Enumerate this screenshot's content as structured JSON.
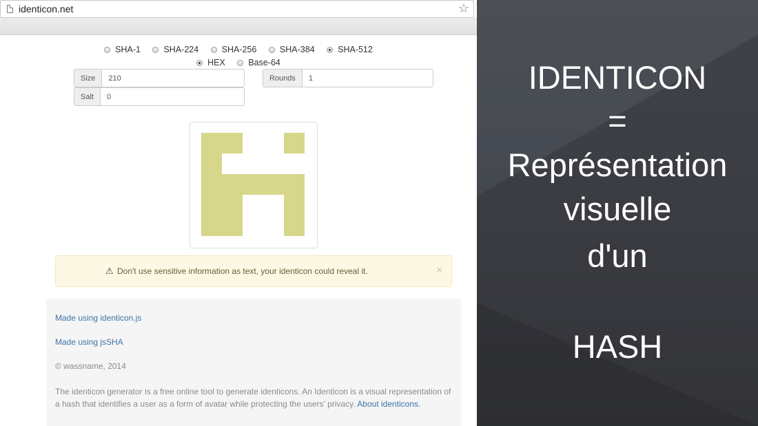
{
  "browser": {
    "url": "identicon.net"
  },
  "hash_options": {
    "algorithms": [
      {
        "label": "SHA-1",
        "selected": false
      },
      {
        "label": "SHA-224",
        "selected": false
      },
      {
        "label": "SHA-256",
        "selected": false
      },
      {
        "label": "SHA-384",
        "selected": false
      },
      {
        "label": "SHA-512",
        "selected": true
      }
    ],
    "encodings": [
      {
        "label": "HEX",
        "selected": true
      },
      {
        "label": "Base-64",
        "selected": false
      }
    ]
  },
  "fields": {
    "size_label": "Size",
    "size_value": "210",
    "rounds_label": "Rounds",
    "rounds_value": "1",
    "salt_label": "Salt",
    "salt_value": "0"
  },
  "identicon": {
    "color": "#d6d78a",
    "grid": [
      [
        1,
        1,
        0,
        0,
        1,
        1
      ],
      [
        1,
        0,
        0,
        0,
        0,
        1
      ],
      [
        1,
        1,
        1,
        1,
        1,
        1
      ],
      [
        1,
        1,
        0,
        0,
        1,
        1
      ],
      [
        1,
        1,
        0,
        0,
        1,
        1
      ]
    ]
  },
  "alert": {
    "warning_icon": "warning-icon",
    "message": "Don't use sensitive information as text, your identicon could reveal it.",
    "close": "×"
  },
  "footer": {
    "link1": "Made using identicon.js",
    "link2": "Made using jsSHA",
    "copyright": "© wassname, 2014",
    "description": "The identicon generator is a free online tool to generate identicons. An Identicon is a visual representation of a hash that identifies a user as a form of avatar while protecting the users' privacy.",
    "about_link": "About identicons."
  },
  "overlay": {
    "line1": "IDENTICON",
    "line2": "=",
    "line3": "Représentation",
    "line4": "visuelle",
    "line5": "d'un",
    "line6": "HASH"
  }
}
